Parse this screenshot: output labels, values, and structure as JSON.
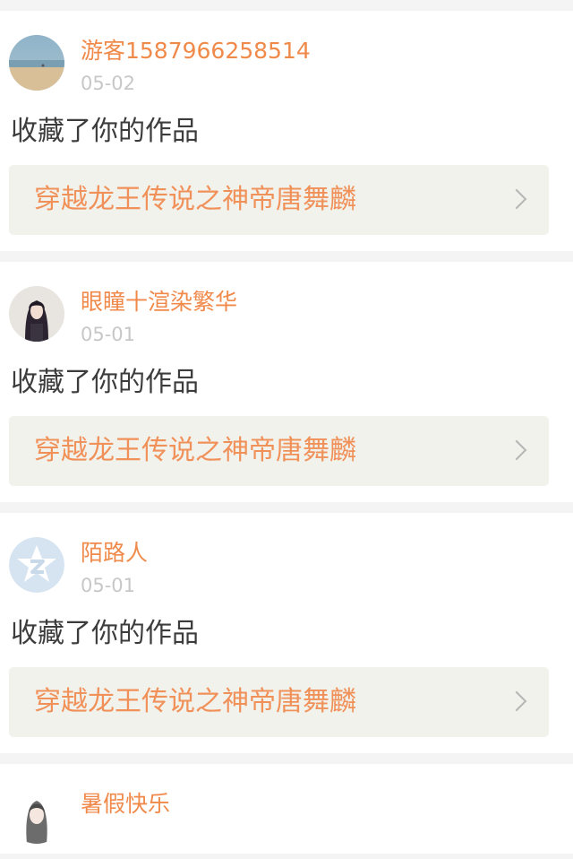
{
  "feed": [
    {
      "username": "游客1587966258514",
      "date": "05-02",
      "action": "收藏了你的作品",
      "work_title": "穿越龙王传说之神帝唐舞麟",
      "avatar_icon": "beach-photo-avatar"
    },
    {
      "username": "眼瞳十渲染繁华",
      "date": "05-01",
      "action": "收藏了你的作品",
      "work_title": "穿越龙王传说之神帝唐舞麟",
      "avatar_icon": "girl-photo-avatar"
    },
    {
      "username": "陌路人",
      "date": "05-01",
      "action": "收藏了你的作品",
      "work_title": "穿越龙王传说之神帝唐舞麟",
      "avatar_icon": "default-star-avatar"
    },
    {
      "username": "暑假快乐",
      "avatar_icon": "anime-girl-avatar"
    }
  ],
  "colors": {
    "username": "#f08a4b",
    "date": "#c7c7c7",
    "action": "#3c3c3c",
    "work_title": "#f0915a",
    "work_bg": "#f2f2ec",
    "page_bg": "#f4f4f4"
  }
}
